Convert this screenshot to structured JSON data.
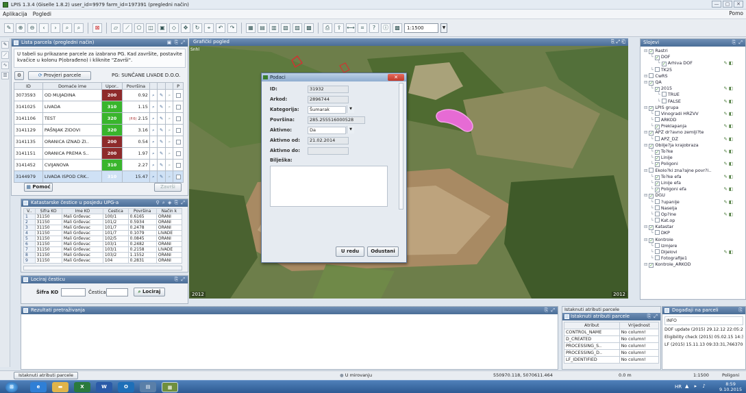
{
  "window": {
    "title": "LPIS 1.3.4 (Giselle 1.8.2) user_id=9979 farm_id=197391 (pregledni način)",
    "controls": [
      "—",
      "▢",
      "✕"
    ]
  },
  "menu": {
    "items": [
      "Aplikacija",
      "Pogledi"
    ],
    "right": "Pomo"
  },
  "toolbar": {
    "scale": "1:1500"
  },
  "parcel_list": {
    "title": "Lista parcela (pregledni način)",
    "info": "U tabeli su prikazane parcele za izabrano PG. Kad završite, postavite kvačice u kolonu P(obrađeno) i kliknite \"Završi\".",
    "refresh_btn": "Provjeri parcele",
    "pg_label": "PG: SUNČANE LIVADE D.O.O.",
    "columns": [
      "ID",
      "Domaće ime",
      "Upor..",
      "Površina",
      "",
      "",
      "",
      "P"
    ],
    "rows": [
      {
        "id": "3073593",
        "name": "OD MUJADINA",
        "kat": "200",
        "kc": "r",
        "area": "0.92"
      },
      {
        "id": "3141025",
        "name": "LIVADA",
        "kat": "310",
        "kc": "g",
        "area": "1.15"
      },
      {
        "id": "3141106",
        "name": "TEST",
        "kat": "320",
        "kc": "g",
        "area": "2.15",
        "warn": "(P.6)"
      },
      {
        "id": "3141129",
        "name": "PAŠNJAK ZIDOVI",
        "kat": "320",
        "kc": "g",
        "area": "3.16"
      },
      {
        "id": "3141135",
        "name": "ORANICA IZNAD ZI..",
        "kat": "200",
        "kc": "r",
        "area": "0.54"
      },
      {
        "id": "3141151",
        "name": "ORANICA PREMA S..",
        "kat": "200",
        "kc": "r",
        "area": "1.97"
      },
      {
        "id": "3141452",
        "name": "CVIJANOVA",
        "kat": "310",
        "kc": "g",
        "area": "2.27"
      },
      {
        "id": "3144979",
        "name": "LIVADA ISPOD CRK..",
        "kat": "310",
        "kc": "g",
        "area": "15.47"
      }
    ],
    "help_btn": "Pomoć",
    "finish_btn": "Završi"
  },
  "cadastre": {
    "title": "Katastarske čestice u posjedu UPG-a",
    "columns": [
      "V..",
      "Šifra KO",
      "Ime KO",
      "Čestica",
      "Površina",
      "Način k"
    ],
    "rows": [
      {
        "n": "1",
        "ko": "31150",
        "ime": "Mali Grđevac",
        "c": "100/1",
        "p": "0.6165",
        "nk": "ORANI"
      },
      {
        "n": "2",
        "ko": "31150",
        "ime": "Mali Grđevac",
        "c": "101/2",
        "p": "0.5934",
        "nk": "ORANI"
      },
      {
        "n": "3",
        "ko": "31150",
        "ime": "Mali Grđevac",
        "c": "101/7",
        "p": "0.2478",
        "nk": "ORANI"
      },
      {
        "n": "4",
        "ko": "31150",
        "ime": "Mali Grđevac",
        "c": "101/7",
        "p": "0.1079",
        "nk": "LIVADE"
      },
      {
        "n": "5",
        "ko": "31150",
        "ime": "Mali Grđevac",
        "c": "102/5",
        "p": "0.0845",
        "nk": "ORANI"
      },
      {
        "n": "6",
        "ko": "31150",
        "ime": "Mali Grđevac",
        "c": "103/1",
        "p": "0.2482",
        "nk": "ORANI"
      },
      {
        "n": "7",
        "ko": "31150",
        "ime": "Mali Grđevac",
        "c": "103/1",
        "p": "0.2158",
        "nk": "LIVADE"
      },
      {
        "n": "8",
        "ko": "31150",
        "ime": "Mali Grđevac",
        "c": "103/2",
        "p": "1.1552",
        "nk": "ORANI"
      },
      {
        "n": "9",
        "ko": "31150",
        "ime": "Mali Grđevac",
        "c": "104",
        "p": "0.2831",
        "nk": "ORANI"
      }
    ]
  },
  "locate": {
    "title": "Lociraj česticu",
    "ko_label": "Šifra KO",
    "c_label": "Čestica",
    "btn": "Lociraj"
  },
  "map": {
    "title": "Grafički pogled",
    "corner": "Snhl",
    "year_left": "2012",
    "year_right": "2012"
  },
  "dialog": {
    "title": "Podaci",
    "fields": [
      {
        "label": "ID:",
        "value": "31932"
      },
      {
        "label": "Arkod:",
        "value": "2896744"
      },
      {
        "label": "Kategorija:",
        "value": "Šumarak"
      },
      {
        "label": "Površina:",
        "value": "285.255516000528"
      },
      {
        "label": "Aktivno:",
        "value": "Da"
      },
      {
        "label": "Aktivno od:",
        "value": "21.02.2014"
      },
      {
        "label": "Aktivno do:",
        "value": ""
      },
      {
        "label": "Bilješka:",
        "value": ""
      }
    ],
    "ok": "U redu",
    "cancel": "Odustani"
  },
  "layers": {
    "title": "Slojevi",
    "items": [
      {
        "t": "Rastri",
        "lvl": 0,
        "c": true
      },
      {
        "t": "DOF",
        "lvl": 1,
        "c": true
      },
      {
        "t": "Arhiva DOF",
        "lvl": 2,
        "c": true
      },
      {
        "t": "TK25",
        "lvl": 1,
        "c": false
      },
      {
        "t": "CwRS",
        "lvl": 0,
        "c": false
      },
      {
        "t": "QA",
        "lvl": 0,
        "c": true
      },
      {
        "t": "2015",
        "lvl": 1,
        "c": true
      },
      {
        "t": "TRUE",
        "lvl": 2,
        "c": false
      },
      {
        "t": "FALSE",
        "lvl": 2,
        "c": false
      },
      {
        "t": "LPIS grupa",
        "lvl": 0,
        "c": true
      },
      {
        "t": "Vinogradi HRZVV",
        "lvl": 1,
        "c": false
      },
      {
        "t": "ARKOD",
        "lvl": 1,
        "c": false
      },
      {
        "t": "Preklapanja",
        "lvl": 1,
        "c": true
      },
      {
        "t": "APZ dr?avno zemlji?te",
        "lvl": 0,
        "c": true
      },
      {
        "t": "APZ_DZ",
        "lvl": 1,
        "c": false
      },
      {
        "t": "Obilje?ja krajobraza",
        "lvl": 0,
        "c": true
      },
      {
        "t": "To?ke",
        "lvl": 1,
        "c": true
      },
      {
        "t": "Linije",
        "lvl": 1,
        "c": true
      },
      {
        "t": "Poligoni",
        "lvl": 1,
        "c": true
      },
      {
        "t": "Ekolo?ki zna?ajne povr?i..",
        "lvl": 0,
        "c": false
      },
      {
        "t": "To?ke efa",
        "lvl": 1,
        "c": true
      },
      {
        "t": "Linije efa",
        "lvl": 1,
        "c": true
      },
      {
        "t": "Poligoni efa",
        "lvl": 1,
        "c": true
      },
      {
        "t": "DGU",
        "lvl": 0,
        "c": true
      },
      {
        "t": "?upanije",
        "lvl": 1,
        "c": false
      },
      {
        "t": "Naselja",
        "lvl": 1,
        "c": false
      },
      {
        "t": "Op?ine",
        "lvl": 1,
        "c": false
      },
      {
        "t": "Kat.op",
        "lvl": 1,
        "c": false
      },
      {
        "t": "Katastar",
        "lvl": 0,
        "c": true
      },
      {
        "t": "DKP",
        "lvl": 1,
        "c": false
      },
      {
        "t": "Kontrole",
        "lvl": 0,
        "c": true
      },
      {
        "t": "Izmjere",
        "lvl": 1,
        "c": false
      },
      {
        "t": "Dijelovi",
        "lvl": 1,
        "c": false
      },
      {
        "t": "Fotografije1",
        "lvl": 1,
        "c": false
      },
      {
        "t": "Kontrole_ARKOD",
        "lvl": 0,
        "c": true
      }
    ]
  },
  "results": {
    "title": "Rezultati pretraživanja"
  },
  "attrs": {
    "tab_label": "Istaknuti atributi parcele",
    "title": "Istaknuti atributi parcele",
    "columns": [
      "Atribut",
      "Vrijednost"
    ],
    "rows": [
      {
        "a": "CONTROL_NAME",
        "v": "No column!"
      },
      {
        "a": "D_CREATED",
        "v": "No column!"
      },
      {
        "a": "PROCESSING_S..",
        "v": "No column!"
      },
      {
        "a": "PROCESSING_D..",
        "v": "No column!"
      },
      {
        "a": "LF_IDENTIFIED",
        "v": "No column!"
      }
    ]
  },
  "events": {
    "title": "Događaji na parceli",
    "header": "INFO",
    "rows": [
      "DOF update (2015) 29.12.12 22:05:20,...",
      "Eligibility check (2015) 05.02.15 14:31:...",
      "LF (2015) 15.11.13 09:33:31,766370-..."
    ]
  },
  "status": {
    "tab": "Istaknuti atributi parcele",
    "state": "U mirovanju",
    "coords": "550970.118, 5070611.464",
    "dist": "0.0 m",
    "scale": "1:1500",
    "layer": "Poligoni"
  },
  "taskbar": {
    "time": "8:59",
    "date": "9.10.2015",
    "lang": "HR"
  }
}
